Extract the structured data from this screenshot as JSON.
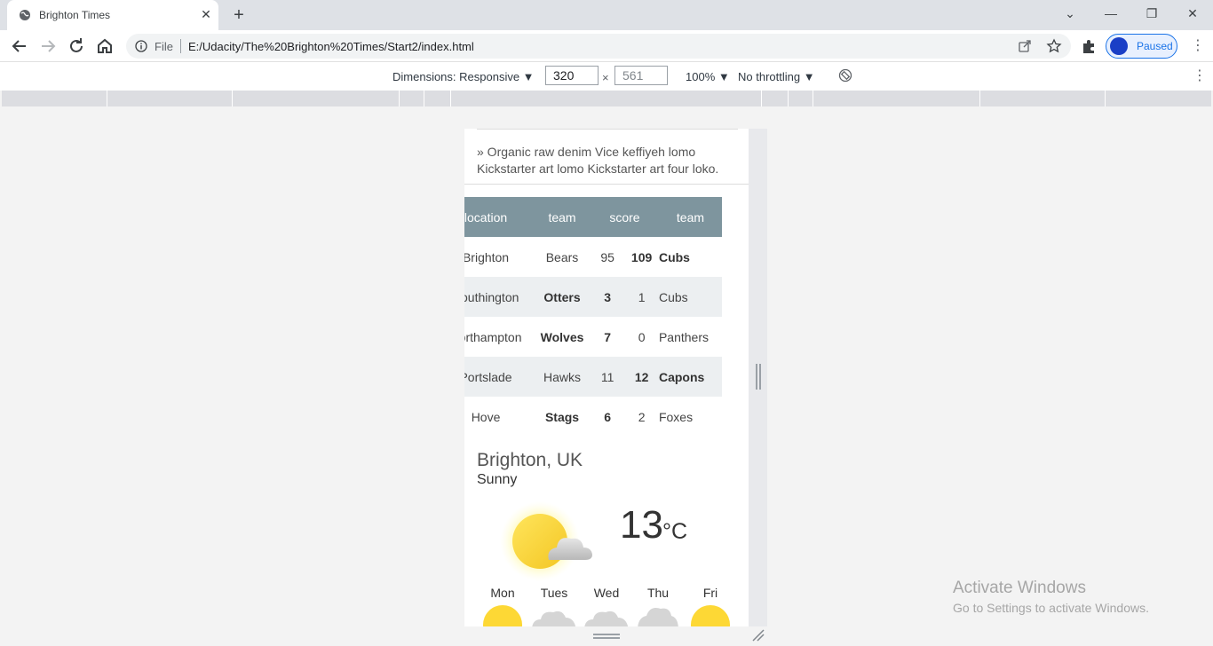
{
  "browser": {
    "tab_title": "Brighton Times",
    "address_scheme_label": "File",
    "address_url": "E:/Udacity/The%20Brighton%20Times/Start2/index.html",
    "profile_label": "Paused",
    "accent": "#1a73e8"
  },
  "devtools": {
    "dimensions_label": "Dimensions: Responsive ▼",
    "width": "320",
    "height": "561",
    "zoom_label": "100% ▼",
    "throttling_label": "No throttling ▼"
  },
  "page": {
    "article_text": "» Organic raw denim Vice keffiyeh lomo Kickstarter art lomo Kickstarter art four loko.",
    "scores": {
      "headers": [
        "location",
        "team",
        "score",
        "team"
      ],
      "rows": [
        {
          "location": "Brighton",
          "team1": "Bears",
          "score1": "95",
          "score2": "109",
          "team2": "Cubs",
          "winner": 2
        },
        {
          "location": "Southington",
          "team1": "Otters",
          "score1": "3",
          "score2": "1",
          "team2": "Cubs",
          "winner": 1
        },
        {
          "location": "Northampton",
          "team1": "Wolves",
          "score1": "7",
          "score2": "0",
          "team2": "Panthers",
          "winner": 1
        },
        {
          "location": "Portslade",
          "team1": "Hawks",
          "score1": "11",
          "score2": "12",
          "team2": "Capons",
          "winner": 2
        },
        {
          "location": "Hove",
          "team1": "Stags",
          "score1": "6",
          "score2": "2",
          "team2": "Foxes",
          "winner": 1
        }
      ],
      "header_color": "#7e959e"
    },
    "weather": {
      "city": "Brighton, UK",
      "condition": "Sunny",
      "temperature": "13",
      "unit": "°C",
      "days": [
        "Mon",
        "Tues",
        "Wed",
        "Thu",
        "Fri"
      ],
      "day_icons": [
        "sun-icon",
        "cloud-icon",
        "cloud-icon",
        "cloud-icon",
        "sun-icon"
      ]
    }
  },
  "os": {
    "activate_title": "Activate Windows",
    "activate_subtitle": "Go to Settings to activate Windows."
  }
}
